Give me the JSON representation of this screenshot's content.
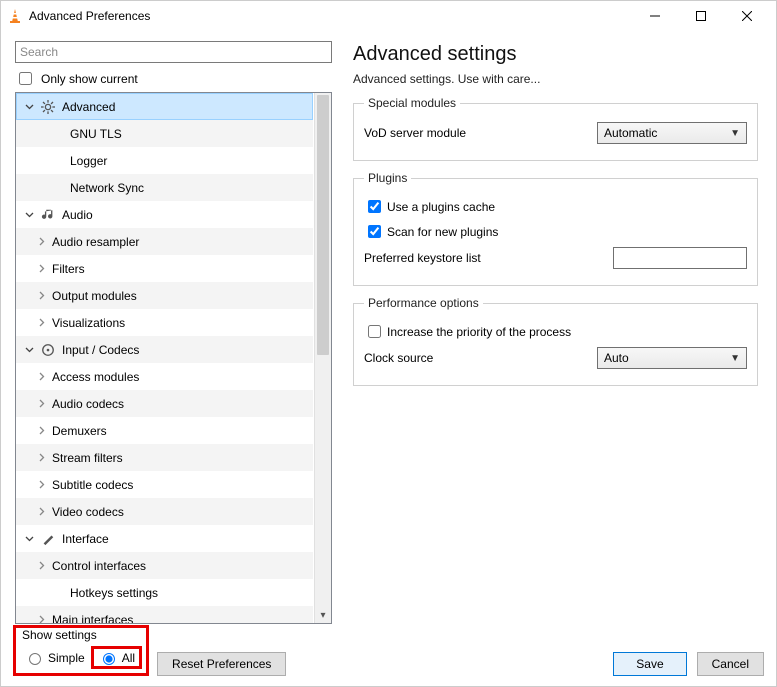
{
  "window": {
    "title": "Advanced Preferences"
  },
  "search": {
    "placeholder": "Search"
  },
  "only_show_current_label": "Only show current",
  "only_show_current_checked": false,
  "tree": [
    {
      "level": 0,
      "expander": "open",
      "icon": "gear",
      "label": "Advanced",
      "selected": true
    },
    {
      "level": 2,
      "expander": "none",
      "icon": "",
      "label": "GNU TLS"
    },
    {
      "level": 2,
      "expander": "none",
      "icon": "",
      "label": "Logger"
    },
    {
      "level": 2,
      "expander": "none",
      "icon": "",
      "label": "Network Sync"
    },
    {
      "level": 0,
      "expander": "open",
      "icon": "note",
      "label": "Audio"
    },
    {
      "level": 1,
      "expander": "closed",
      "icon": "",
      "label": "Audio resampler"
    },
    {
      "level": 1,
      "expander": "closed",
      "icon": "",
      "label": "Filters"
    },
    {
      "level": 1,
      "expander": "closed",
      "icon": "",
      "label": "Output modules"
    },
    {
      "level": 1,
      "expander": "closed",
      "icon": "",
      "label": "Visualizations"
    },
    {
      "level": 0,
      "expander": "open",
      "icon": "disc",
      "label": "Input / Codecs"
    },
    {
      "level": 1,
      "expander": "closed",
      "icon": "",
      "label": "Access modules"
    },
    {
      "level": 1,
      "expander": "closed",
      "icon": "",
      "label": "Audio codecs"
    },
    {
      "level": 1,
      "expander": "closed",
      "icon": "",
      "label": "Demuxers"
    },
    {
      "level": 1,
      "expander": "closed",
      "icon": "",
      "label": "Stream filters"
    },
    {
      "level": 1,
      "expander": "closed",
      "icon": "",
      "label": "Subtitle codecs"
    },
    {
      "level": 1,
      "expander": "closed",
      "icon": "",
      "label": "Video codecs"
    },
    {
      "level": 0,
      "expander": "open",
      "icon": "brush",
      "label": "Interface"
    },
    {
      "level": 1,
      "expander": "closed",
      "icon": "",
      "label": "Control interfaces"
    },
    {
      "level": 2,
      "expander": "none",
      "icon": "",
      "label": "Hotkeys settings"
    },
    {
      "level": 1,
      "expander": "closed",
      "icon": "",
      "label": "Main interfaces"
    }
  ],
  "right": {
    "heading": "Advanced settings",
    "description": "Advanced settings. Use with care...",
    "groups": {
      "special_modules": {
        "legend": "Special modules",
        "vod_label": "VoD server module",
        "vod_value": "Automatic"
      },
      "plugins": {
        "legend": "Plugins",
        "use_cache_label": "Use a plugins cache",
        "use_cache_checked": true,
        "scan_label": "Scan for new plugins",
        "scan_checked": true,
        "keystore_label": "Preferred keystore list",
        "keystore_value": ""
      },
      "performance": {
        "legend": "Performance options",
        "increase_priority_label": "Increase the priority of the process",
        "increase_priority_checked": false,
        "clock_label": "Clock source",
        "clock_value": "Auto"
      }
    }
  },
  "footer": {
    "show_settings_label": "Show settings",
    "simple_label": "Simple",
    "all_label": "All",
    "selected_mode": "all",
    "reset_label": "Reset Preferences",
    "save_label": "Save",
    "cancel_label": "Cancel"
  }
}
